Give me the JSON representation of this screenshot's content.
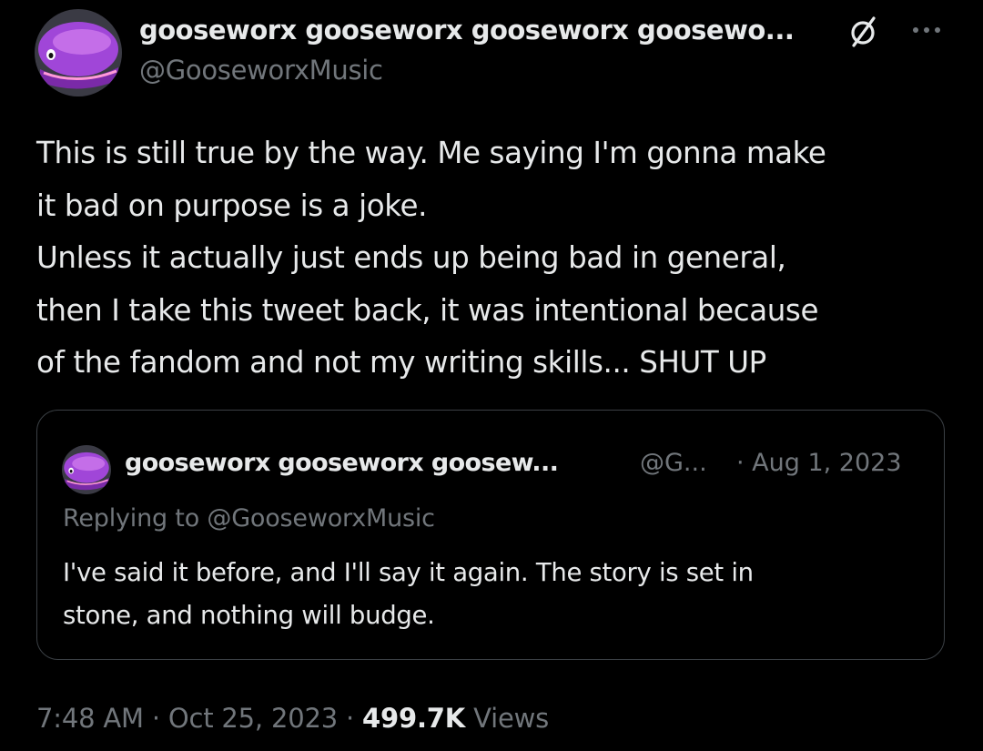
{
  "tweet": {
    "author": {
      "display_name": "gooseworx gooseworx gooseworx goosewo...",
      "handle": "@GooseworxMusic",
      "avatar_icon": "purple-creature-avatar",
      "badge_icon": "slashed-circle-icon"
    },
    "menu_icon": "more-options-icon",
    "text_lines": [
      "This is still true by the way. Me saying I'm gonna make",
      "it bad on purpose is a joke.",
      "Unless it actually just ends up being bad in general,",
      "then I take this tweet back, it was intentional because",
      "of the fandom and not my writing skills... SHUT UP"
    ],
    "quoted": {
      "display_name": "gooseworx gooseworx goosew...",
      "handle": "@G...",
      "date": "· Aug 1, 2023",
      "replying_to": "Replying to @GooseworxMusic",
      "text_lines": [
        "I've said it before, and I'll say it again. The story is set in",
        "stone, and nothing will budge."
      ]
    },
    "meta": {
      "time": "7:48 AM",
      "separator_1": " · ",
      "date": "Oct 25, 2023",
      "separator_2": " · ",
      "views_count": "499.7K",
      "views_label": " Views"
    }
  },
  "colors": {
    "background": "#000000",
    "text_primary": "#e7e9ea",
    "text_secondary": "#71767b",
    "border": "#3b4045",
    "avatar_purple": "#9b3fd1"
  }
}
